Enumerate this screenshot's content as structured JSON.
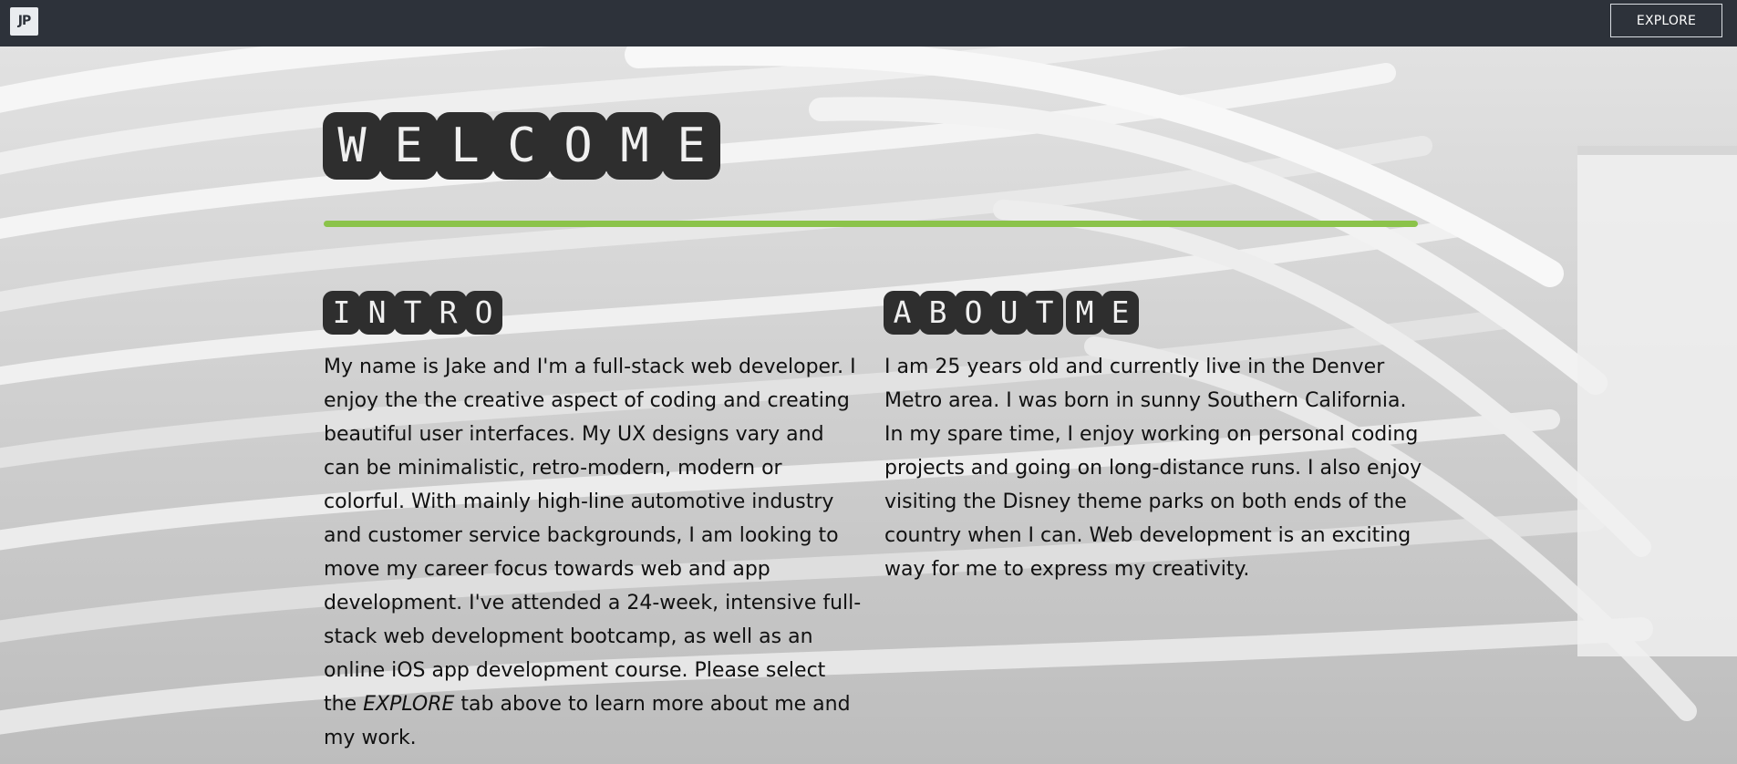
{
  "nav": {
    "logo_text": "JP",
    "explore_label": "EXPLORE",
    "background": "#2d323a"
  },
  "hero": {
    "title_letters": [
      "W",
      "E",
      "L",
      "C",
      "O",
      "M",
      "E"
    ],
    "rule_color": "#8bc34a"
  },
  "intro": {
    "title_letters": [
      "I",
      "N",
      "T",
      "R",
      "O"
    ],
    "text_before": "My name is Jake and I'm a full-stack web developer. I enjoy the the creative aspect of coding and creating beautiful user interfaces. My UX designs vary and can be minimalistic, retro-modern, modern or colorful. With mainly high-line automotive industry and customer service backgrounds, I am looking to move my career focus towards web and app development. I've attended a 24-week, intensive full-stack web development bootcamp, as well as an online iOS app development course. Please select the ",
    "text_emphasis": "EXPLORE",
    "text_after": " tab above to learn more about me and my work."
  },
  "about": {
    "title_letters": [
      "A",
      "B",
      "O",
      "U",
      "T",
      "M",
      "E"
    ],
    "text": "I am 25 years old and currently live in the Denver Metro area. I was born in sunny Southern California. In my spare time, I enjoy working on personal coding projects and going on long-distance runs. I also enjoy visiting the Disney theme parks on both ends of the country when I can. Web development is an exciting way for me to express my creativity."
  }
}
